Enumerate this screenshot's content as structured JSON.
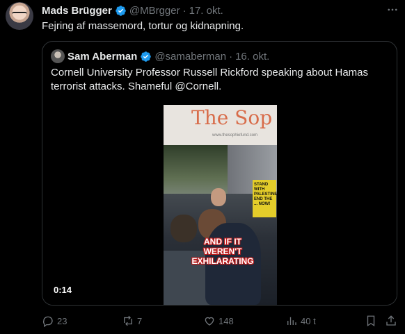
{
  "tweet": {
    "author_name": "Mads Brügger",
    "author_handle": "@MBrgger",
    "separator": "·",
    "time": "17. okt.",
    "text": "Fejring af massemord, tortur og kidnapning.",
    "avatar_icon": "author-avatar",
    "verified_color": "#1d9bf0"
  },
  "quote": {
    "author_name": "Sam Aberman",
    "author_handle": "@samaberman",
    "separator": "·",
    "time": "16. okt.",
    "text": "Cornell University Professor Russell Rickford speaking about Hamas terrorist attacks. Shameful @Cornell.",
    "video": {
      "banner_text": "The Sop",
      "banner_url": "www.thesophiefund.com",
      "sign_text": "STAND WITH PALESTINE END THE ... NOW!",
      "caption": "AND IF IT WEREN'T EXHILARATING",
      "duration": "0:14"
    }
  },
  "actions": {
    "replies": "23",
    "reposts": "7",
    "likes": "148",
    "views": "40 t"
  }
}
